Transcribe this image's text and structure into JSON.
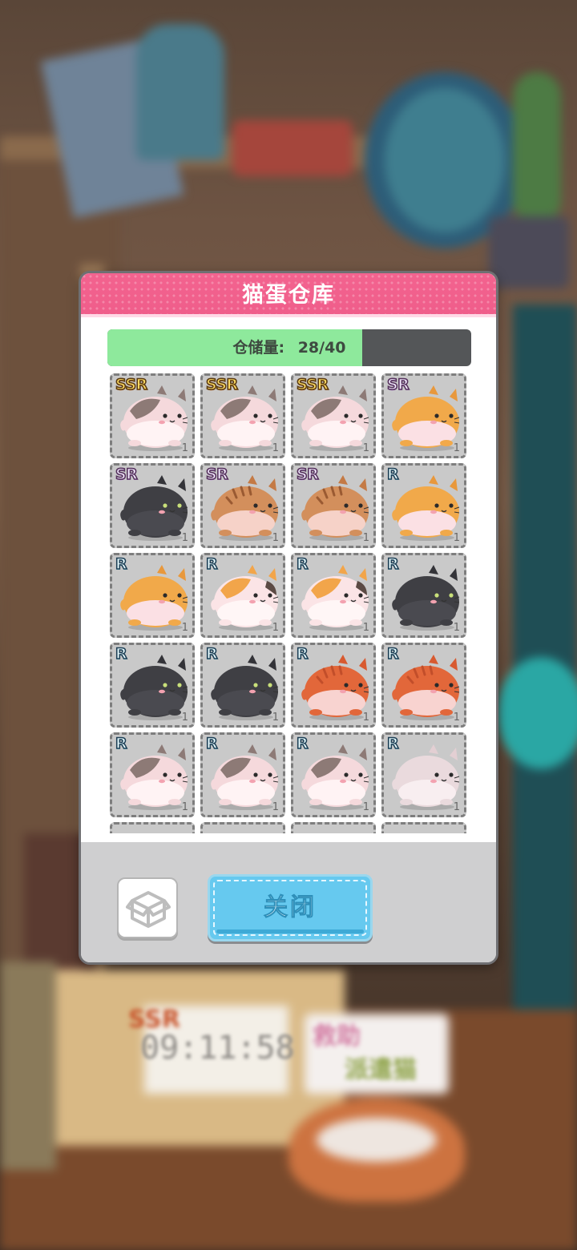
{
  "background": {
    "timer_text": "09:11:58",
    "timer_badge": "SSR",
    "sign_line1": "救助",
    "sign_line2": "派遣猫"
  },
  "dialog": {
    "title": "猫蛋仓库",
    "storage_label": "仓储量:",
    "storage_value": "28/40",
    "storage_fraction": 0.7,
    "close_label": "关闭"
  },
  "cats": [
    {
      "rarity": "SSR",
      "count": "1",
      "breed": "calico-grey"
    },
    {
      "rarity": "SSR",
      "count": "1",
      "breed": "calico-grey"
    },
    {
      "rarity": "SSR",
      "count": "1",
      "breed": "calico-grey"
    },
    {
      "rarity": "SR",
      "count": "1",
      "breed": "orange"
    },
    {
      "rarity": "SR",
      "count": "1",
      "breed": "black"
    },
    {
      "rarity": "SR",
      "count": "1",
      "breed": "tabby"
    },
    {
      "rarity": "SR",
      "count": "1",
      "breed": "tabby"
    },
    {
      "rarity": "R",
      "count": "1",
      "breed": "orange"
    },
    {
      "rarity": "R",
      "count": "1",
      "breed": "orange"
    },
    {
      "rarity": "R",
      "count": "1",
      "breed": "calico-orange"
    },
    {
      "rarity": "R",
      "count": "1",
      "breed": "calico-orange"
    },
    {
      "rarity": "R",
      "count": "1",
      "breed": "black"
    },
    {
      "rarity": "R",
      "count": "1",
      "breed": "black"
    },
    {
      "rarity": "R",
      "count": "1",
      "breed": "black"
    },
    {
      "rarity": "R",
      "count": "1",
      "breed": "ginger"
    },
    {
      "rarity": "R",
      "count": "1",
      "breed": "ginger"
    },
    {
      "rarity": "R",
      "count": "1",
      "breed": "calico-grey"
    },
    {
      "rarity": "R",
      "count": "1",
      "breed": "calico-grey"
    },
    {
      "rarity": "R",
      "count": "1",
      "breed": "calico-grey"
    },
    {
      "rarity": "R",
      "count": "1",
      "breed": "pale"
    }
  ],
  "palette": {
    "header_pink": "#ef5d8a",
    "storage_green": "#8ee99c",
    "close_blue": "#66c9ef",
    "cell_grey": "#c9c9c9"
  }
}
